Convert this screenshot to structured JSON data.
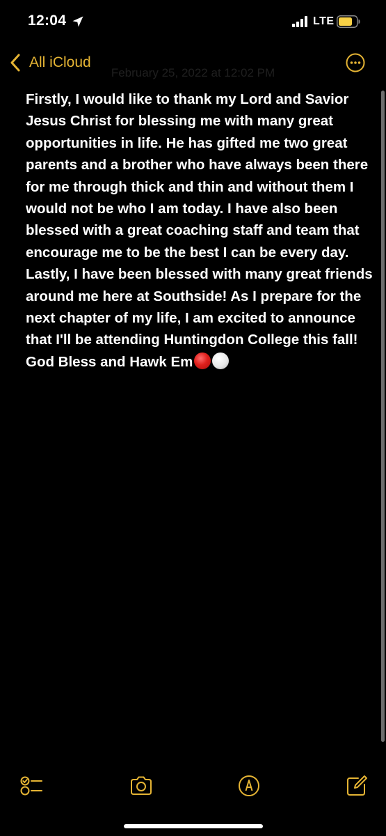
{
  "status_bar": {
    "time": "12:04",
    "network": "LTE",
    "icons": [
      "location-arrow-icon",
      "signal-bars-icon",
      "battery-icon"
    ]
  },
  "nav": {
    "back_label": "All iCloud",
    "date": "February 25, 2022 at 12:02 PM",
    "more_icon": "ellipsis-circle-icon"
  },
  "note": {
    "text": "Firstly, I would like to thank my Lord and Savior Jesus Christ for blessing me with many great opportunities in life. He has gifted me two great parents and a brother who have always been there for me through thick and thin and without them I would not be who I am today. I have also been blessed with a great coaching staff and team that encourage me to be the best I can be every day. Lastly, I have been blessed with many great friends around me here at Southside! As I prepare for the next chapter of my life, I am excited to announce that I'll be attending Huntingdon College this fall! God Bless and Hawk Em",
    "emoji": [
      "red-circle",
      "white-circle"
    ]
  },
  "toolbar": {
    "items": [
      "checklist-icon",
      "camera-icon",
      "markup-pen-icon",
      "compose-icon"
    ]
  },
  "colors": {
    "accent": "#e5b434",
    "background": "#000000",
    "text": "#ffffff",
    "battery_fill": "#f7d046"
  }
}
